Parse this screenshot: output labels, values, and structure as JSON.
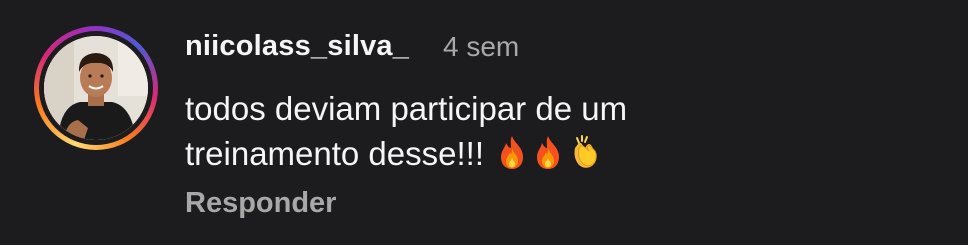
{
  "comment": {
    "username": "niicolass_silva_",
    "timestamp": "4 sem",
    "text": "todos deviam participar de um treinamento desse!!!",
    "emojis": [
      "fire-emoji",
      "fire-emoji",
      "clapping-hands-emoji"
    ],
    "reply_label": "Responder"
  },
  "colors": {
    "background": "#1c1c1e",
    "primary_text": "#f5f5f5",
    "secondary_text": "#a8a8a8"
  }
}
